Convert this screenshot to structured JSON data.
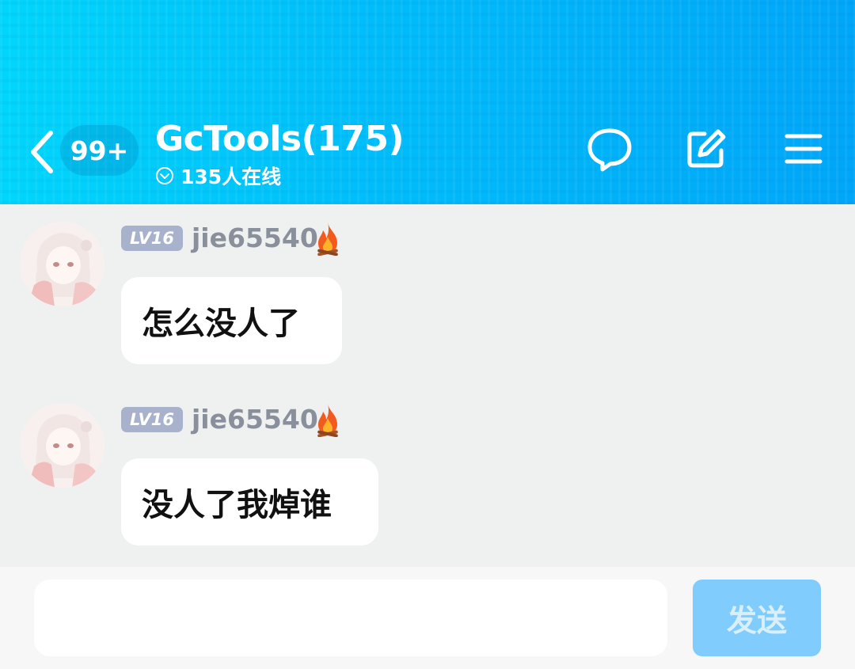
{
  "colors": {
    "header_start": "#00d6fb",
    "header_end": "#00a6f8",
    "chat_background": "#eef1ef",
    "level_badge": "#a9b2cd",
    "username": "#8a8f9c",
    "send_button": "#80cdfd"
  },
  "header": {
    "back_icon": "chevron-left-icon",
    "unread_badge": "99+",
    "title": "GcTools(175)",
    "online_icon": "chevron-down-circle-icon",
    "online_text": "135人在线",
    "actions": [
      "chat-bubble-icon",
      "edit-icon",
      "menu-icon"
    ]
  },
  "messages": [
    {
      "avatar": "avatar-image",
      "level": "LV16",
      "username": "jie65540",
      "badge_icon": "fire-icon",
      "text": "怎么没人了"
    },
    {
      "avatar": "avatar-image",
      "level": "LV16",
      "username": "jie65540",
      "badge_icon": "fire-icon",
      "text": "没人了我焯谁"
    }
  ],
  "input": {
    "value": "",
    "placeholder": "",
    "send_label": "发送"
  }
}
